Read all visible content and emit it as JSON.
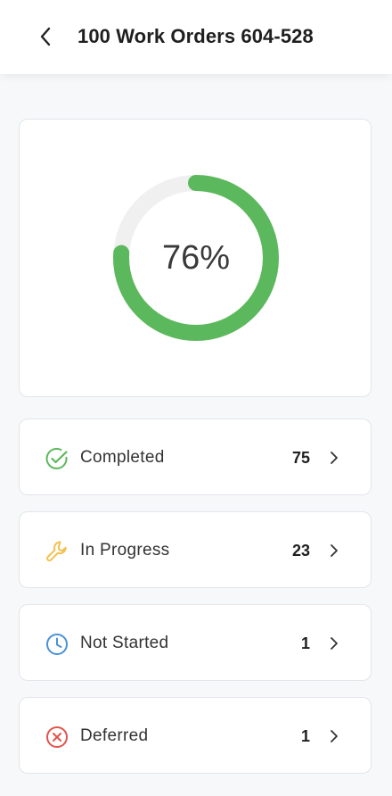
{
  "header": {
    "title": "100 Work Orders 604-528",
    "back_icon": "chevron-left-icon"
  },
  "progress": {
    "percent_label": "76%",
    "completion_fraction": 0.76,
    "colors": {
      "arc": "#5cb85c",
      "track": "#f0f0f0"
    }
  },
  "status_rows": [
    {
      "label": "Completed",
      "count": "75",
      "icon": "check-circle-icon",
      "color": "#5cb85c"
    },
    {
      "label": "In Progress",
      "count": "23",
      "icon": "wrench-icon",
      "color": "#f2c14e"
    },
    {
      "label": "Not Started",
      "count": "1",
      "icon": "clock-icon",
      "color": "#4a90d9"
    },
    {
      "label": "Deferred",
      "count": "1",
      "icon": "x-circle-icon",
      "color": "#e0534a"
    }
  ]
}
